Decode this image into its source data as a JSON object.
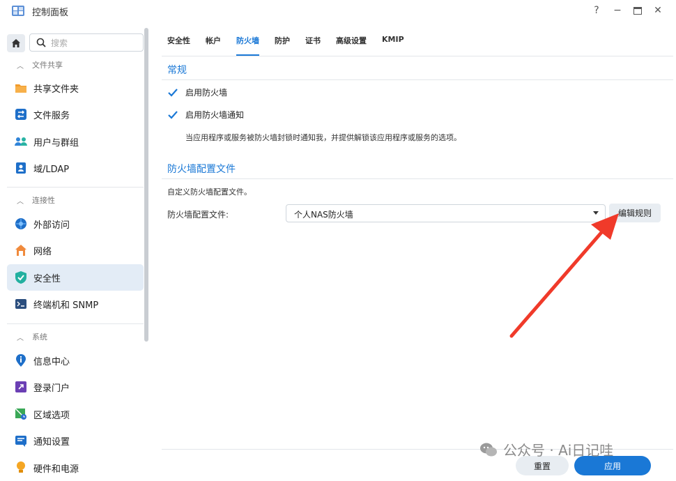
{
  "app": {
    "title": "控制面板"
  },
  "window_controls": {
    "help": "?",
    "minimize": "−",
    "maximize": "▭",
    "close": "✕"
  },
  "search": {
    "placeholder": "搜索"
  },
  "sidebar": {
    "sections": [
      {
        "label": "文件共享",
        "items": [
          {
            "label": "共享文件夹",
            "icon": "folder-icon"
          },
          {
            "label": "文件服务",
            "icon": "file-services-icon"
          },
          {
            "label": "用户与群组",
            "icon": "users-icon"
          },
          {
            "label": "域/LDAP",
            "icon": "domain-icon"
          }
        ]
      },
      {
        "label": "连接性",
        "items": [
          {
            "label": "外部访问",
            "icon": "external-access-icon"
          },
          {
            "label": "网络",
            "icon": "network-icon"
          },
          {
            "label": "安全性",
            "icon": "shield-icon",
            "active": true
          },
          {
            "label": "终端机和 SNMP",
            "icon": "terminal-icon"
          }
        ]
      },
      {
        "label": "系统",
        "items": [
          {
            "label": "信息中心",
            "icon": "info-icon"
          },
          {
            "label": "登录门户",
            "icon": "login-portal-icon"
          },
          {
            "label": "区域选项",
            "icon": "region-icon"
          },
          {
            "label": "通知设置",
            "icon": "notification-icon"
          },
          {
            "label": "硬件和电源",
            "icon": "bulb-icon"
          }
        ]
      }
    ]
  },
  "tabs": [
    {
      "label": "安全性"
    },
    {
      "label": "帐户"
    },
    {
      "label": "防火墙",
      "active": true
    },
    {
      "label": "防护"
    },
    {
      "label": "证书"
    },
    {
      "label": "高级设置"
    },
    {
      "label": "KMIP"
    }
  ],
  "general": {
    "title": "常规",
    "enable_firewall": {
      "label": "启用防火墙",
      "checked": true
    },
    "enable_notify": {
      "label": "启用防火墙通知",
      "checked": true
    },
    "notify_desc": "当应用程序或服务被防火墙封锁时通知我，并提供解锁该应用程序或服务的选项。"
  },
  "profile": {
    "title": "防火墙配置文件",
    "desc": "自定义防火墙配置文件。",
    "field_label": "防火墙配置文件:",
    "selected": "个人NAS防火墙",
    "edit_button": "编辑规则"
  },
  "footer": {
    "reset": "重置",
    "apply": "应用"
  },
  "watermark": {
    "text": "公众号 · Ai日记哇"
  },
  "colors": {
    "accent": "#1a78d6",
    "arrow": "#f03a2a",
    "active_bg": "#e3ecf6"
  }
}
